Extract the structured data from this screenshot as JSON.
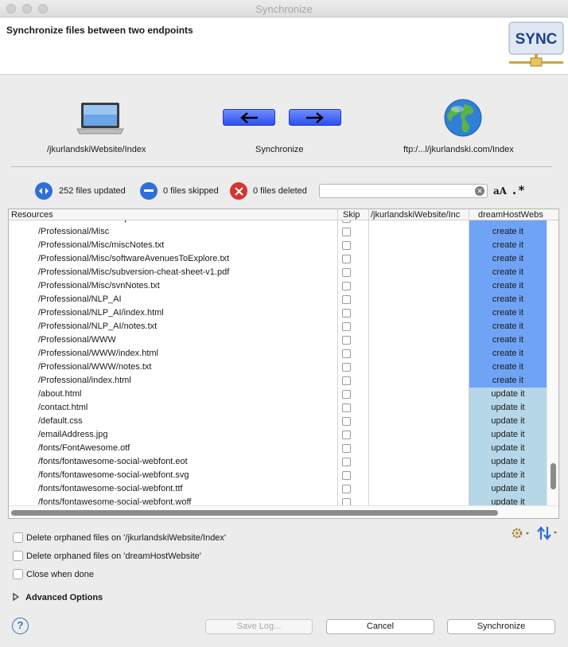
{
  "window": {
    "title": "Synchronize"
  },
  "header": {
    "title": "Synchronize files between two endpoints",
    "logo_text": "SYNC"
  },
  "endpoints": {
    "source_label": "/jkurlandskiWebsite/Index",
    "sync_label": "Synchronize",
    "target_label": "ftp:/...l/jkurlandski.com/Index"
  },
  "stats": {
    "updated": "252 files updated",
    "skipped": "0 files skipped",
    "deleted": "0 files deleted",
    "filter_value": "",
    "case_toggle": "aA",
    "regex_toggle": ".*"
  },
  "table": {
    "columns": [
      "Resources",
      "Skip",
      "/jkurlandskiWebsite/Inc",
      "dreamHostWebs"
    ],
    "rows": [
      {
        "resource": "/Professional/Java/mapSort.html",
        "action": "create it",
        "kind": "create"
      },
      {
        "resource": "/Professional/Misc",
        "action": "create it",
        "kind": "create"
      },
      {
        "resource": "/Professional/Misc/miscNotes.txt",
        "action": "create it",
        "kind": "create"
      },
      {
        "resource": "/Professional/Misc/softwareAvenuesToExplore.txt",
        "action": "create it",
        "kind": "create"
      },
      {
        "resource": "/Professional/Misc/subversion-cheat-sheet-v1.pdf",
        "action": "create it",
        "kind": "create"
      },
      {
        "resource": "/Professional/Misc/svnNotes.txt",
        "action": "create it",
        "kind": "create"
      },
      {
        "resource": "/Professional/NLP_AI",
        "action": "create it",
        "kind": "create"
      },
      {
        "resource": "/Professional/NLP_AI/index.html",
        "action": "create it",
        "kind": "create"
      },
      {
        "resource": "/Professional/NLP_AI/notes.txt",
        "action": "create it",
        "kind": "create"
      },
      {
        "resource": "/Professional/WWW",
        "action": "create it",
        "kind": "create"
      },
      {
        "resource": "/Professional/WWW/index.html",
        "action": "create it",
        "kind": "create"
      },
      {
        "resource": "/Professional/WWW/notes.txt",
        "action": "create it",
        "kind": "create"
      },
      {
        "resource": "/Professional/index.html",
        "action": "create it",
        "kind": "create"
      },
      {
        "resource": "/about.html",
        "action": "update it",
        "kind": "update"
      },
      {
        "resource": "/contact.html",
        "action": "update it",
        "kind": "update"
      },
      {
        "resource": "/default.css",
        "action": "update it",
        "kind": "update"
      },
      {
        "resource": "/emailAddress.jpg",
        "action": "update it",
        "kind": "update"
      },
      {
        "resource": "/fonts/FontAwesome.otf",
        "action": "update it",
        "kind": "update"
      },
      {
        "resource": "/fonts/fontawesome-social-webfont.eot",
        "action": "update it",
        "kind": "update"
      },
      {
        "resource": "/fonts/fontawesome-social-webfont.svg",
        "action": "update it",
        "kind": "update"
      },
      {
        "resource": "/fonts/fontawesome-social-webfont.ttf",
        "action": "update it",
        "kind": "update"
      },
      {
        "resource": "/fonts/fontawesome-social-webfont.woff",
        "action": "update it",
        "kind": "update"
      }
    ]
  },
  "options": {
    "delete_source": "Delete orphaned files on '/jkurlandskiWebsite/Index'",
    "delete_target": "Delete orphaned files on 'dreamHostWebsite'",
    "close_when_done": "Close when done",
    "advanced": "Advanced Options"
  },
  "buttons": {
    "save_log": "Save Log...",
    "cancel": "Cancel",
    "synchronize": "Synchronize",
    "help": "?"
  },
  "colors": {
    "create": "#6fa3f5",
    "update": "#b6d7e8",
    "arrow": "#2d4ff0"
  }
}
